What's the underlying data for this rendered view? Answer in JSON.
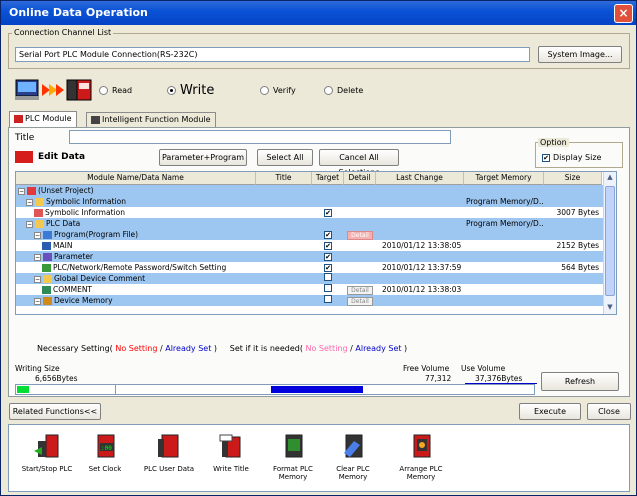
{
  "window": {
    "title": "Online Data Operation",
    "close_glyph": "×"
  },
  "connection": {
    "group_label": "Connection Channel List",
    "value": "Serial Port  PLC Module Connection(RS-232C)",
    "system_image_button": "System Image..."
  },
  "mode": {
    "read": "Read",
    "write": "Write",
    "verify": "Verify",
    "delete": "Delete",
    "selected": "write"
  },
  "tabs": [
    {
      "label": "PLC Module"
    },
    {
      "label": "Intelligent Function Module"
    }
  ],
  "title_field": {
    "label": "Title",
    "value": ""
  },
  "toolbar": {
    "edit_data": "Edit Data",
    "param_program": "Parameter+Program",
    "select_all": "Select All",
    "cancel_all": "Cancel All Selections"
  },
  "option": {
    "group_label": "Option",
    "display_size": "Display Size",
    "checked": true
  },
  "table": {
    "headers": [
      "Module Name/Data Name",
      "Title",
      "Target",
      "Detail",
      "Last Change",
      "Target Memory",
      "Size"
    ],
    "rows": [
      {
        "name": "(Unset Project)",
        "title": "",
        "target": "",
        "detail": "",
        "last_change": "",
        "memory": "",
        "size": "",
        "selected": true,
        "indent": 0,
        "icon": "project-icon"
      },
      {
        "name": "Symbolic Information",
        "title": "",
        "target": "",
        "detail": "",
        "last_change": "",
        "memory": "Program Memory/D...",
        "size": "",
        "selected": true,
        "indent": 1,
        "icon": "folder-icon"
      },
      {
        "name": "Symbolic Information",
        "title": "",
        "target": "checked",
        "detail": "",
        "last_change": "",
        "memory": "",
        "size": "3007 Bytes",
        "selected": false,
        "indent": 2,
        "icon": "symbol-icon"
      },
      {
        "name": "PLC Data",
        "title": "",
        "target": "",
        "detail": "",
        "last_change": "",
        "memory": "Program Memory/D...",
        "size": "",
        "selected": true,
        "indent": 1,
        "icon": "folder-icon"
      },
      {
        "name": "Program(Program File)",
        "title": "",
        "target": "checked",
        "detail": "Detail",
        "last_change": "",
        "memory": "",
        "size": "",
        "selected": true,
        "indent": 2,
        "icon": "program-icon"
      },
      {
        "name": "MAIN",
        "title": "",
        "target": "checked",
        "detail": "",
        "last_change": "2010/01/12 13:38:05",
        "memory": "",
        "size": "2152 Bytes",
        "selected": false,
        "indent": 3,
        "icon": "main-icon"
      },
      {
        "name": "Parameter",
        "title": "",
        "target": "checked",
        "detail": "",
        "last_change": "",
        "memory": "",
        "size": "",
        "selected": true,
        "indent": 2,
        "icon": "parameter-icon"
      },
      {
        "name": "PLC/Network/Remote Password/Switch Setting",
        "title": "",
        "target": "checked",
        "detail": "",
        "last_change": "2010/01/12 13:37:59",
        "memory": "",
        "size": "564 Bytes",
        "selected": false,
        "indent": 3,
        "icon": "setting-icon"
      },
      {
        "name": "Global Device Comment",
        "title": "",
        "target": "unchecked",
        "detail": "",
        "last_change": "",
        "memory": "",
        "size": "",
        "selected": true,
        "indent": 2,
        "icon": "folder-icon"
      },
      {
        "name": "COMMENT",
        "title": "",
        "target": "unchecked",
        "detail": "Detail",
        "last_change": "2010/01/12 13:38:03",
        "memory": "",
        "size": "",
        "selected": false,
        "indent": 3,
        "icon": "comment-icon"
      },
      {
        "name": "Device Memory",
        "title": "",
        "target": "unchecked",
        "detail": "Detail",
        "last_change": "",
        "memory": "",
        "size": "",
        "selected": true,
        "indent": 2,
        "icon": "device-memory-icon"
      }
    ]
  },
  "legend": {
    "necessary": "Necessary Setting(",
    "no_setting": "No Setting",
    "slash": "/",
    "already_set": "Already Set",
    "close": ")",
    "if_needed": "Set if it is needed(",
    "no_setting2": "No Setting",
    "already_set2": "Already Set",
    "close2": ")"
  },
  "volume": {
    "writing_label": "Writing Size",
    "writing_value": "6,656Bytes",
    "free_label": "Free Volume",
    "free_value": "77,312",
    "use_label": "Use Volume",
    "use_value": "37,376Bytes",
    "refresh": "Refresh"
  },
  "actions": {
    "related": "Related Functions<<",
    "execute": "Execute",
    "close": "Close"
  },
  "related_functions": [
    {
      "label": "Start/Stop PLC",
      "icon": "start-stop-plc-icon"
    },
    {
      "label": "Set Clock",
      "icon": "set-clock-icon"
    },
    {
      "label": "PLC User Data",
      "icon": "plc-user-data-icon"
    },
    {
      "label": "Write Title",
      "icon": "write-title-icon"
    },
    {
      "label": "Format PLC\nMemory",
      "icon": "format-plc-memory-icon"
    },
    {
      "label": "Clear PLC Memory",
      "icon": "clear-plc-memory-icon"
    },
    {
      "label": "Arrange PLC\nMemory",
      "icon": "arrange-plc-memory-icon"
    }
  ]
}
